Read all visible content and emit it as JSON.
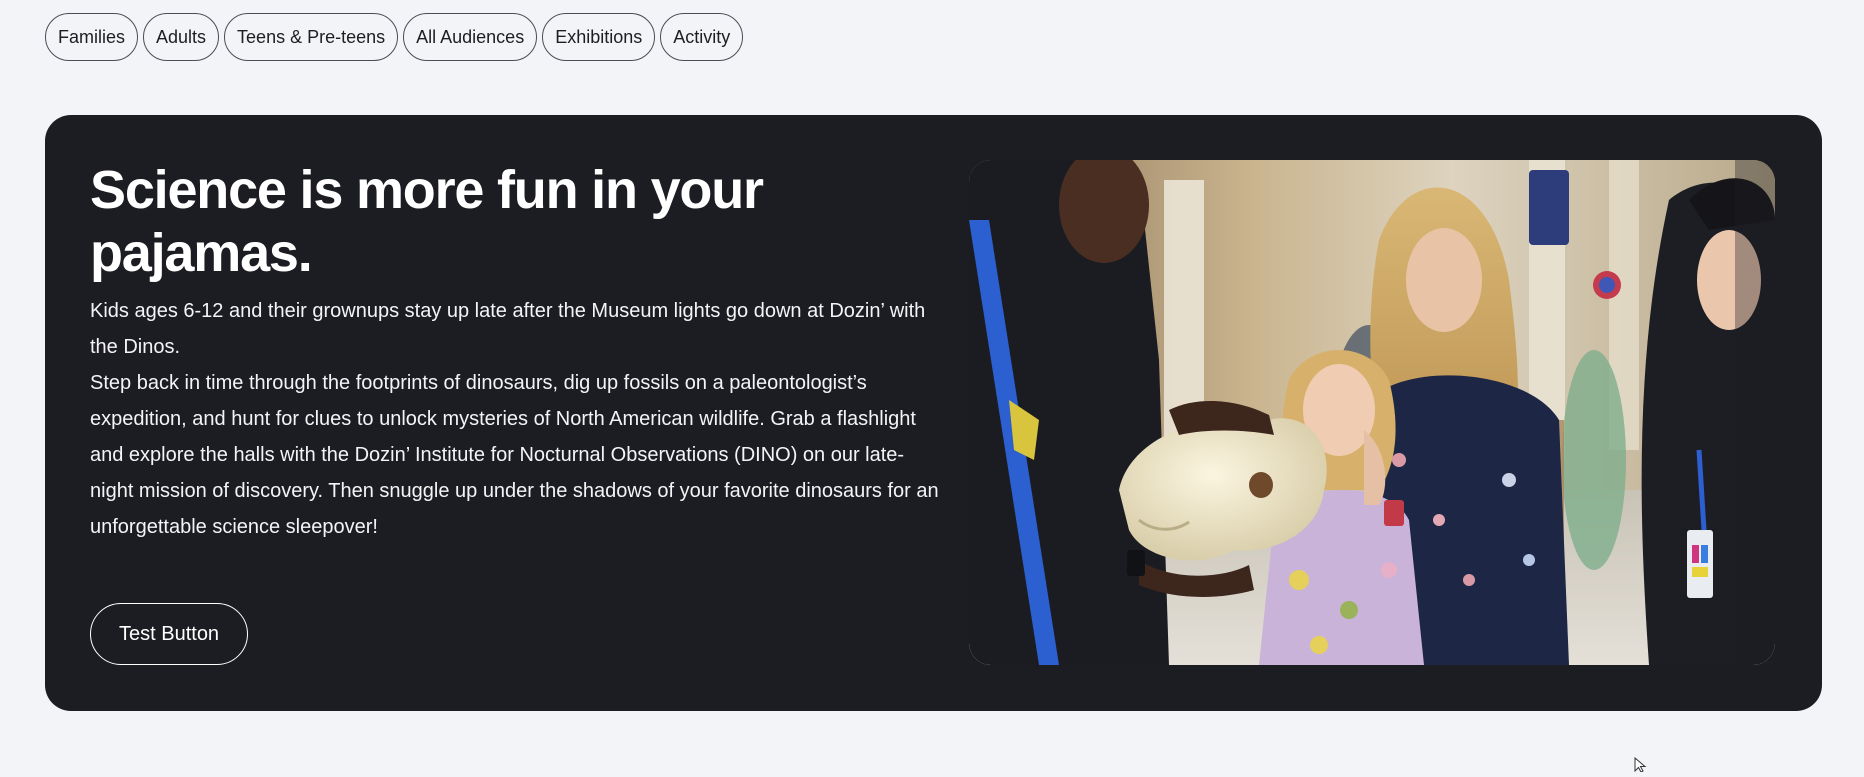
{
  "filters": [
    {
      "label": "Families"
    },
    {
      "label": "Adults"
    },
    {
      "label": "Teens & Pre-teens"
    },
    {
      "label": "All Audiences"
    },
    {
      "label": "Exhibitions"
    },
    {
      "label": "Activity"
    }
  ],
  "hero": {
    "title": "Science is more fun in your pajamas.",
    "paragraphs": [
      "Kids ages 6-12 and their grownups stay up late after the Museum lights go down at Dozin’ with the Dinos.",
      "Step back in time through the footprints of dinosaurs, dig up fossils on a paleontologist’s expedition, and hunt for clues to unlock mysteries of North American wildlife. Grab a flashlight and explore the halls with the Dozin’ Institute for Nocturnal Observations (DINO) on our late-night mission of discovery. Then snuggle up under the shadows of your favorite dinosaurs for an unforgettable science sleepover!"
    ],
    "button_label": "Test Button",
    "image_icon": "photo-museum-visitors-examining-skull"
  },
  "colors": {
    "page_bg": "#f2f4f8",
    "hero_bg": "#1c1d22",
    "text_light": "#ffffff",
    "chip_border": "#4a4d55"
  }
}
